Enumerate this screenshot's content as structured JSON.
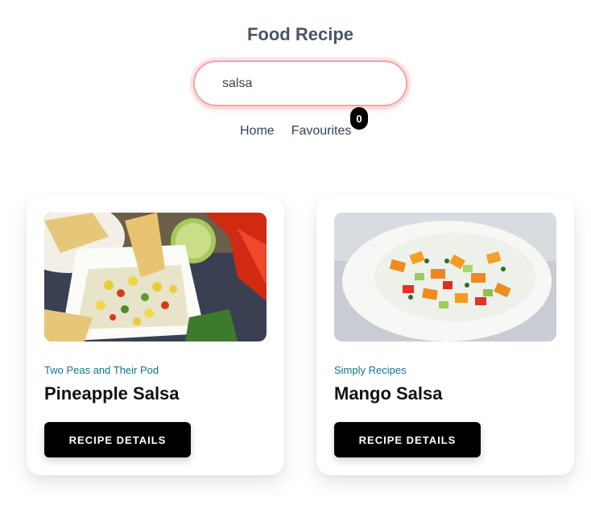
{
  "app": {
    "title": "Food Recipe"
  },
  "search": {
    "value": "salsa",
    "placeholder": ""
  },
  "nav": {
    "home_label": "Home",
    "favourites_label": "Favourites",
    "favourites_count": "0"
  },
  "recipes": [
    {
      "publisher": "Two Peas and Their Pod",
      "title": "Pineapple Salsa",
      "button_label": "RECIPE DETAILS",
      "image": "pineapple-salsa-photo"
    },
    {
      "publisher": "Simply Recipes",
      "title": "Mango Salsa",
      "button_label": "RECIPE DETAILS",
      "image": "mango-salsa-photo"
    }
  ],
  "colors": {
    "search_border": "#f4a3a3",
    "publisher_text": "#0e7490",
    "button_bg": "#000000",
    "title_text": "#4b5563"
  }
}
